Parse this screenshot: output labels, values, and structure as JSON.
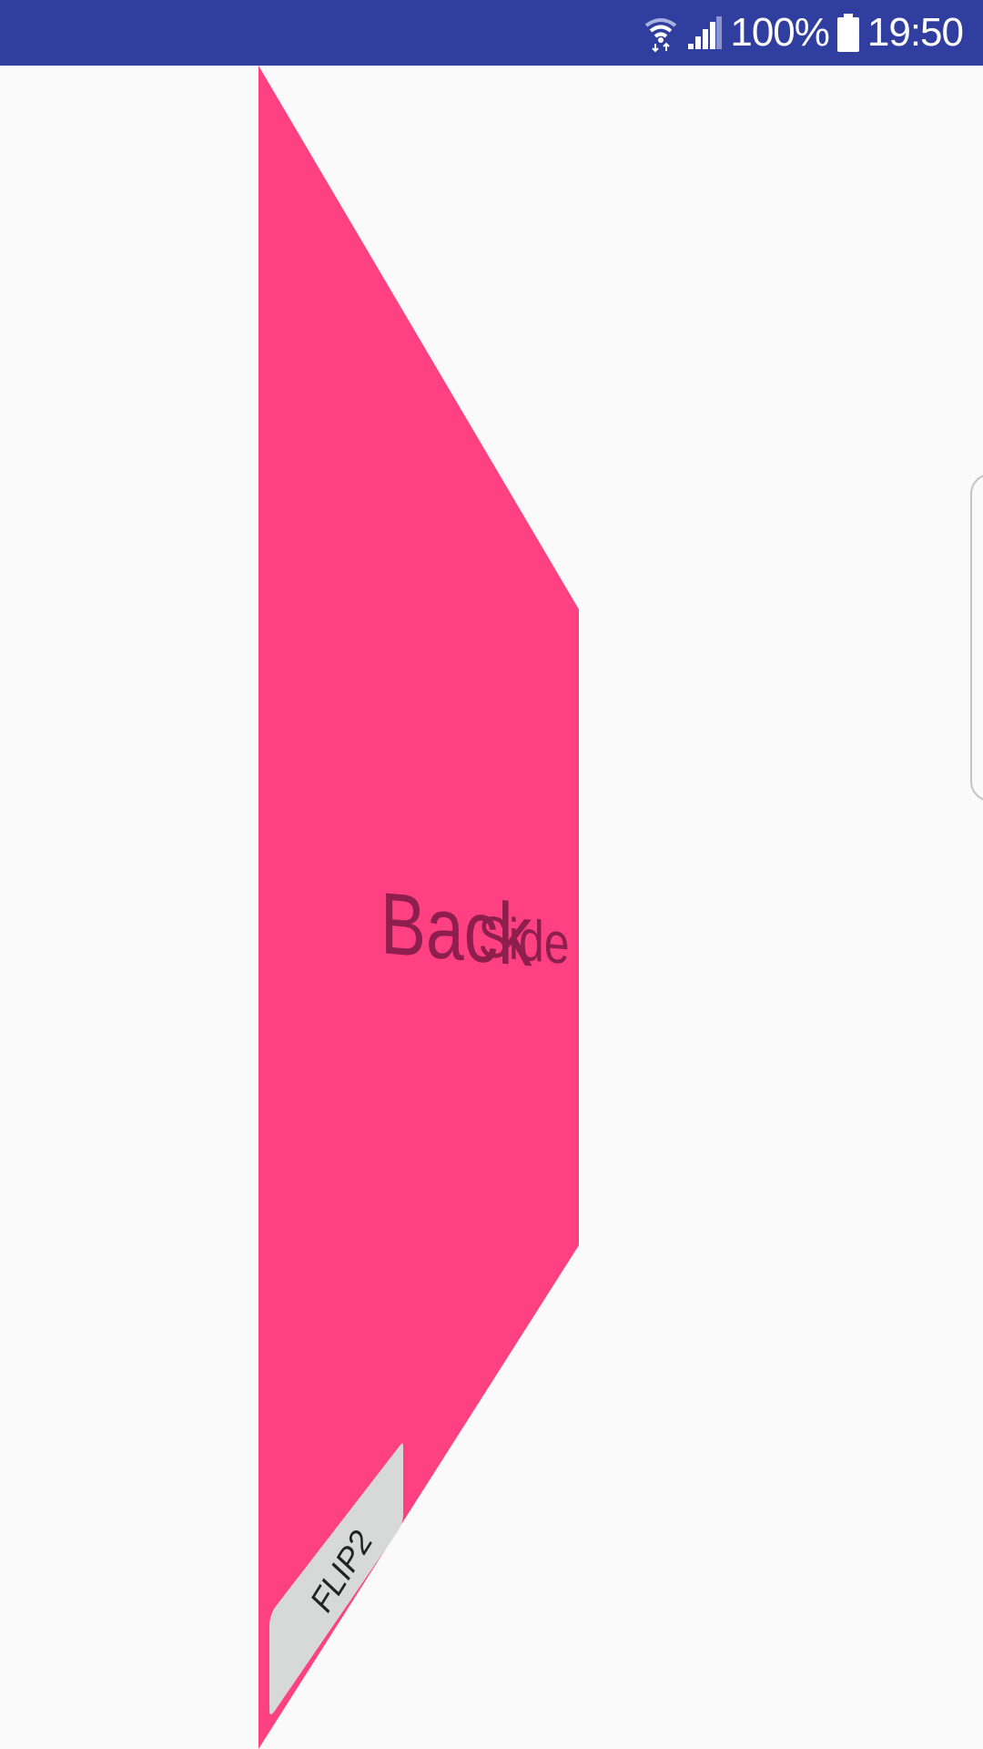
{
  "status_bar": {
    "battery_percent": "100%",
    "time": "19:50",
    "icons": [
      "wifi-icon",
      "signal-icon",
      "battery-icon"
    ]
  },
  "card": {
    "label": "Back Side",
    "label_word_1": "Back",
    "label_word_2": "Side",
    "color": "#ff4081",
    "text_color": "#8e1e4e"
  },
  "flip_button": {
    "label": "FLIP2"
  },
  "colors": {
    "status_bar": "#303f9f",
    "background": "#fafafa",
    "button": "#d7d8d8"
  }
}
